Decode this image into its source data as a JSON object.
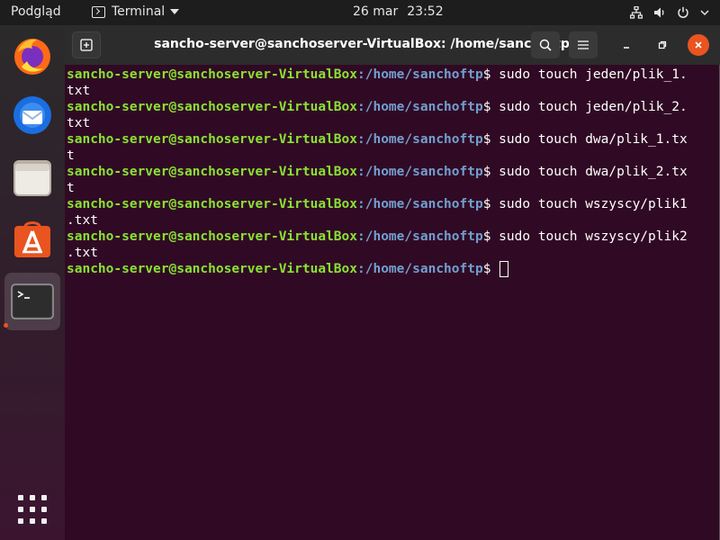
{
  "topbar": {
    "activities": "Podgląd",
    "app_name": "Terminal",
    "date": "26 mar",
    "time": "23:52",
    "tray_icons": [
      "network-icon",
      "volume-icon",
      "power-icon",
      "chevron-down-icon"
    ]
  },
  "dock": {
    "items": [
      "firefox-icon",
      "thunderbird-icon",
      "files-icon",
      "ubuntu-software-icon",
      "terminal-icon"
    ],
    "active_item": "terminal-icon",
    "apps_grid": "show-applications-icon"
  },
  "window": {
    "title": "sancho-server@sanchoserver-VirtualBox: /home/sanchoftp"
  },
  "terminal": {
    "user_host": "sancho-server@sanchoserver-VirtualBox",
    "path": ":/home/sanchoftp",
    "prompt_end": "$ ",
    "lines": [
      {
        "cmd_1": "sudo touch jeden/plik_1.",
        "cmd_2": "txt"
      },
      {
        "cmd_1": "sudo touch jeden/plik_2.",
        "cmd_2": "txt"
      },
      {
        "cmd_1": "sudo touch dwa/plik_1.tx",
        "cmd_2": "t"
      },
      {
        "cmd_1": "sudo touch dwa/plik_2.tx",
        "cmd_2": "t"
      },
      {
        "cmd_1": "sudo touch wszyscy/plik1",
        "cmd_2": ".txt"
      },
      {
        "cmd_1": "sudo touch wszyscy/plik2",
        "cmd_2": ".txt"
      }
    ]
  },
  "colors": {
    "terminal_bg": "#300a24",
    "user_host": "#8ae234",
    "path": "#729fcf",
    "accent": "#e95420"
  }
}
